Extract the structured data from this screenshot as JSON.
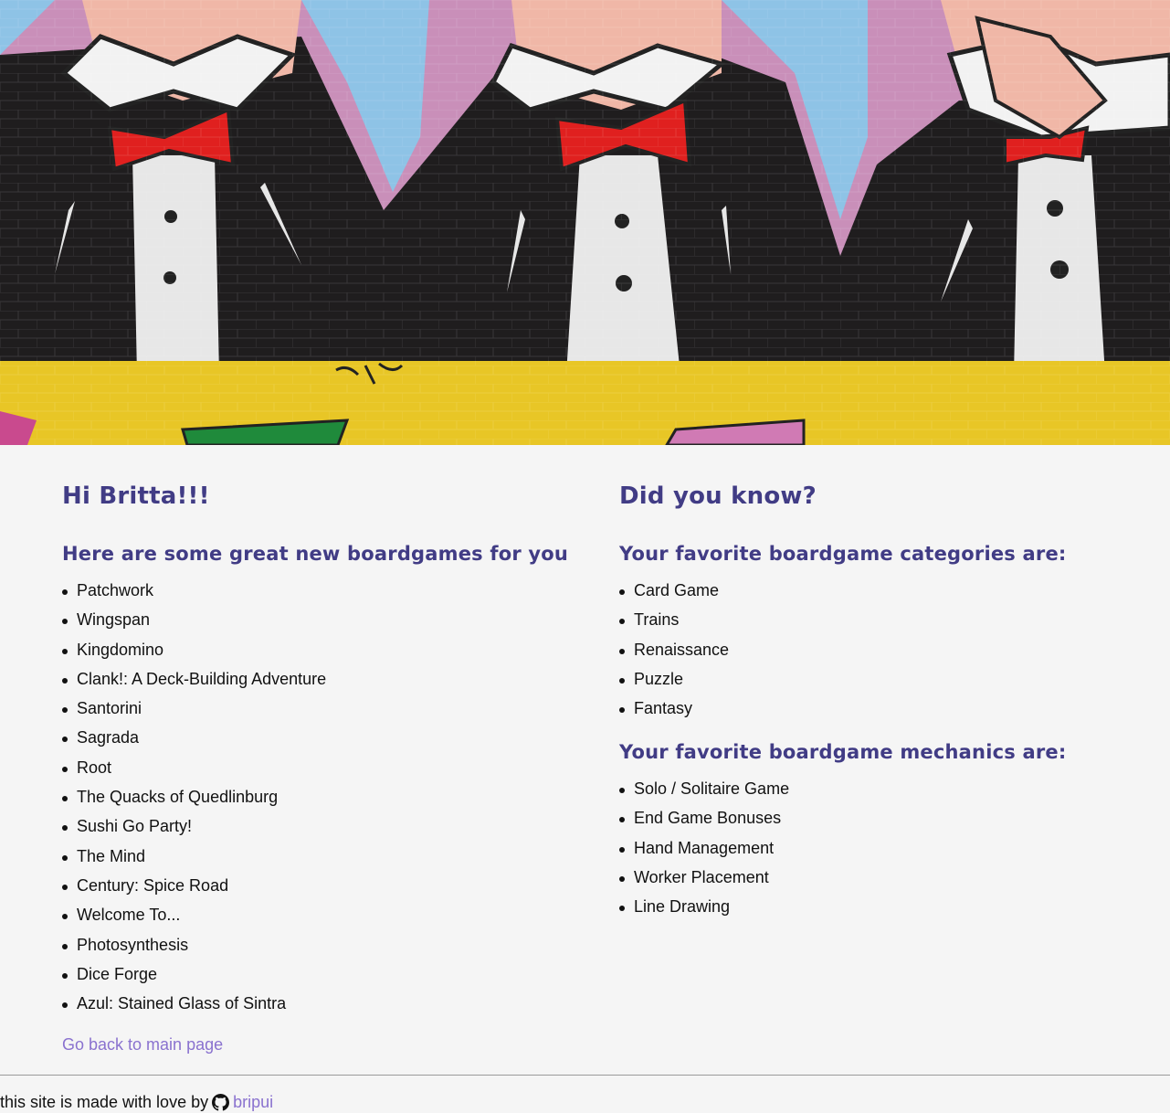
{
  "hero": {
    "image_alt": "Graffiti mural of three Monopoly men in tuxedos with red bow ties"
  },
  "left": {
    "greeting": "Hi Britta!!!",
    "recommend_title": "Here are some great new boardgames for you",
    "games": [
      "Patchwork",
      "Wingspan",
      "Kingdomino",
      "Clank!: A Deck-Building Adventure",
      "Santorini",
      "Sagrada",
      "Root",
      "The Quacks of Quedlinburg",
      "Sushi Go Party!",
      "The Mind",
      "Century: Spice Road",
      "Welcome To...",
      "Photosynthesis",
      "Dice Forge",
      "Azul: Stained Glass of Sintra"
    ],
    "back_link": "Go back to main page"
  },
  "right": {
    "title": "Did you know?",
    "categories_title": "Your favorite boardgame categories are:",
    "categories": [
      "Card Game",
      "Trains",
      "Renaissance",
      "Puzzle",
      "Fantasy"
    ],
    "mechanics_title": "Your favorite boardgame mechanics are:",
    "mechanics": [
      "Solo / Solitaire Game",
      "End Game Bonuses",
      "Hand Management",
      "Worker Placement",
      "Line Drawing"
    ]
  },
  "footer": {
    "text": "this site is made with love by",
    "icon": "github-icon",
    "author_link": "bripui"
  },
  "colors": {
    "heading": "#413c85",
    "link": "#8a72cf",
    "background": "#f5f5f5"
  }
}
